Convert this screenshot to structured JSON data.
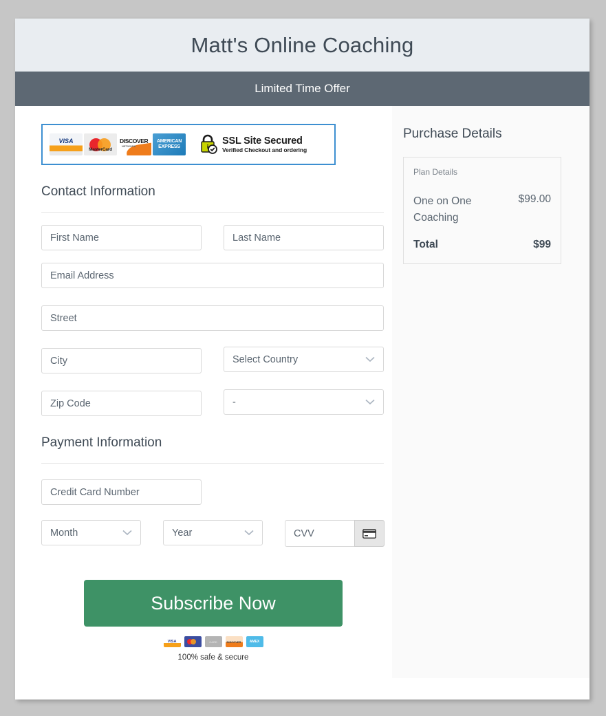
{
  "header": {
    "brand_title": "Matt's Online Coaching",
    "offer_text": "Limited Time Offer"
  },
  "trust_badge": {
    "cards": [
      {
        "name": "visa",
        "label": "VISA"
      },
      {
        "name": "mastercard",
        "label": "MasterCard"
      },
      {
        "name": "discover",
        "label": "DISCOVER",
        "sub": "NETWORK"
      },
      {
        "name": "american-express",
        "label": "AMERICAN EXPRESS"
      }
    ],
    "ssl_title": "SSL Site Secured",
    "ssl_subtitle": "Verified Checkout and ordering"
  },
  "contact_section": {
    "heading": "Contact Information",
    "first_name_placeholder": "First Name",
    "last_name_placeholder": "Last Name",
    "email_placeholder": "Email Address",
    "street_placeholder": "Street",
    "city_placeholder": "City",
    "country_value": "Select Country",
    "zip_placeholder": "Zip Code",
    "state_value": "-"
  },
  "payment_section": {
    "heading": "Payment Information",
    "card_number_placeholder": "Credit Card Number",
    "month_value": "Month",
    "year_value": "Year",
    "cvv_placeholder": "CVV"
  },
  "submit": {
    "label": "Subscribe Now",
    "safe_text": "100% safe & secure",
    "footer_cards": [
      {
        "name": "visa",
        "label": "VISA"
      },
      {
        "name": "mastercard",
        "label": ""
      },
      {
        "name": "generic-card",
        "label": "CARD"
      },
      {
        "name": "discover",
        "label": "DISCOVER"
      },
      {
        "name": "amex",
        "label": "AMEX"
      }
    ]
  },
  "summary": {
    "title": "Purchase Details",
    "plan_label": "Plan Details",
    "plan_name": "One on One Coaching",
    "plan_price": "$99.00",
    "total_label": "Total",
    "total_price": "$99"
  },
  "colors": {
    "offer_bar": "#5d6873",
    "header_bg": "#e9edf1",
    "accent_green": "#3e9266",
    "badge_border": "#3d8fd1",
    "page_bg": "#c6c6c6"
  }
}
